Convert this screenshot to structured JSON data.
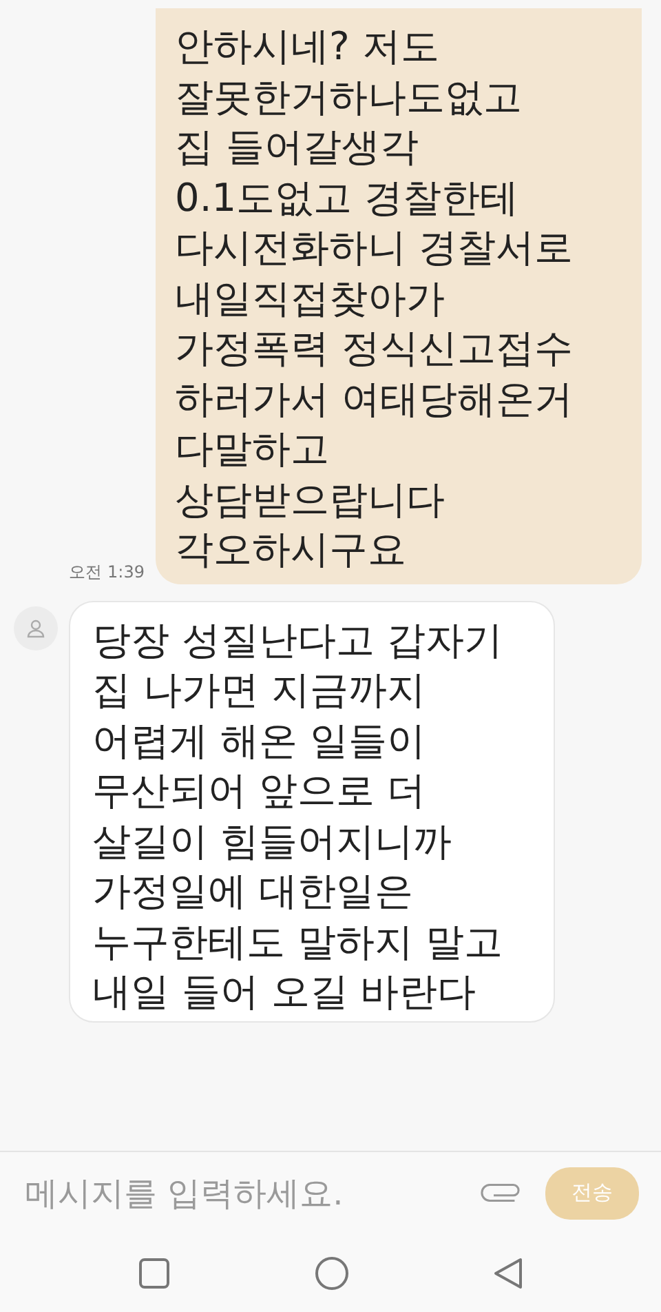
{
  "messages": [
    {
      "kind": "sent",
      "text": "안하시네? 저도\n잘못한거하나도없고\n집 들어갈생각\n0.1도없고 경찰한테\n다시전화하니 경찰서로\n내일직접찾아가\n가정폭력 정식신고접수\n하러가서 여태당해온거\n다말하고\n상담받으랍니다\n각오하시구요",
      "time": "오전 1:39"
    },
    {
      "kind": "received",
      "text": "당장 성질난다고 갑자기\n집 나가면 지금까지\n어렵게 해온 일들이\n무산되어 앞으로 더\n살길이 힘들어지니까\n가정일에 대한일은\n누구한테도 말하지 말고\n내일 들어 오길 바란다"
    }
  ],
  "composer": {
    "placeholder": "메시지를 입력하세요.",
    "send": "전송"
  }
}
